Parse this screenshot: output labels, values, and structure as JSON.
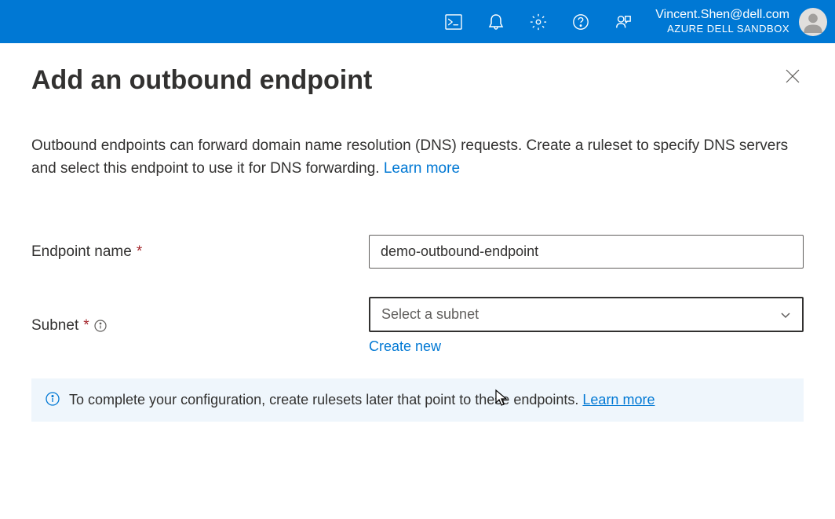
{
  "header": {
    "user_email": "Vincent.Shen@dell.com",
    "tenant": "AZURE DELL SANDBOX"
  },
  "page": {
    "title": "Add an outbound endpoint",
    "description": "Outbound endpoints can forward domain name resolution (DNS) requests. Create a ruleset to specify DNS servers and select this endpoint to use it for DNS forwarding.",
    "learn_more": "Learn more"
  },
  "form": {
    "endpoint_name_label": "Endpoint name",
    "endpoint_name_value": "demo-outbound-endpoint",
    "subnet_label": "Subnet",
    "subnet_placeholder": "Select a subnet",
    "create_new": "Create new"
  },
  "banner": {
    "text": "To complete your configuration, create rulesets later that point to these endpoints.",
    "learn_more": "Learn more"
  }
}
